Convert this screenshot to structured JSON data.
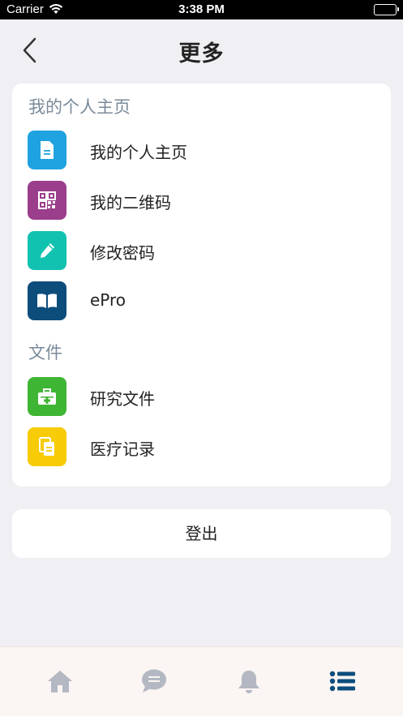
{
  "status_bar": {
    "carrier": "Carrier",
    "time": "3:38 PM"
  },
  "nav": {
    "title": "更多"
  },
  "sections": [
    {
      "title": "我的个人主页",
      "items": [
        {
          "label": "我的个人主页",
          "icon": "document-icon",
          "color": "#1fa2e0"
        },
        {
          "label": "我的二维码",
          "icon": "qr-code-icon",
          "color": "#9b3f8c"
        },
        {
          "label": "修改密码",
          "icon": "pencil-icon",
          "color": "#12c2b0"
        },
        {
          "label": "ePro",
          "icon": "book-icon",
          "color": "#0c4d7c"
        }
      ]
    },
    {
      "title": "文件",
      "items": [
        {
          "label": "研究文件",
          "icon": "medical-kit-icon",
          "color": "#3fb534"
        },
        {
          "label": "医疗记录",
          "icon": "records-icon",
          "color": "#f7cb06"
        }
      ]
    }
  ],
  "logout": {
    "label": "登出"
  },
  "tab_bar": {
    "tabs": [
      {
        "icon": "home-icon",
        "active": false
      },
      {
        "icon": "chat-icon",
        "active": false
      },
      {
        "icon": "bell-icon",
        "active": false
      },
      {
        "icon": "list-icon",
        "active": true
      }
    ],
    "active_color": "#0c4d7c",
    "inactive_color": "#b3b8c2"
  }
}
